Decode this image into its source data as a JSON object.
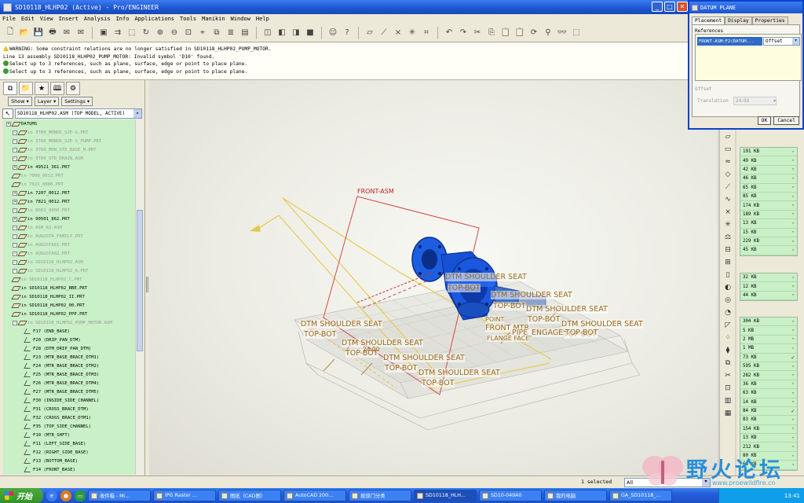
{
  "window": {
    "title": "SD10118_HLHP02 (Active) - Pro/ENGINEER",
    "controls": [
      "minimize",
      "maximize",
      "close"
    ]
  },
  "menu": [
    "File",
    "Edit",
    "View",
    "Insert",
    "Analysis",
    "Info",
    "Applications",
    "Tools",
    "Manikin",
    "Window",
    "Help"
  ],
  "messages": [
    {
      "icon": "warning-icon",
      "text": "WARNING: Some constraint relations are no longer satisfied in SD10118_HLHP02_PUMP_MOTOR."
    },
    {
      "icon": "",
      "text": " Line 13 assembly SD10118_HLHP02_PUMP_MOTOR: Invalid symbol 'D10' found."
    },
    {
      "icon": "prompt-icon",
      "text": "Select up to 3 references, such as plane, surface, edge or point to place plane."
    },
    {
      "icon": "prompt-icon",
      "text": "Select up to 3 references, such as plane, surface, edge or point to place plane."
    }
  ],
  "left_panel": {
    "buttons": {
      "show": "Show",
      "layer": "Layer",
      "settings": "Settings"
    },
    "model_selector": "SD10118_HLHP02.ASM (TOP MODEL, ACTIVE)",
    "tree": [
      {
        "text": "DATUMS",
        "type": "folder",
        "dim": false,
        "indent": 0,
        "plus": true
      },
      {
        "text": "in 3T00_MONOD_SZE-S.PRT",
        "type": "part",
        "dim": true,
        "indent": 1,
        "plus": true
      },
      {
        "text": "in 3T00_MONOD_SZE-S_PUMP.PRT",
        "type": "part",
        "dim": true,
        "indent": 1,
        "plus": true
      },
      {
        "text": "in 3T00_MON_STD_BASE_M.PRT",
        "type": "part",
        "dim": true,
        "indent": 1,
        "plus": true
      },
      {
        "text": "in 3T00_STD_DRAIN.ASM",
        "type": "part",
        "dim": true,
        "indent": 1,
        "plus": true
      },
      {
        "text": "in 49521_361.PRT",
        "type": "part",
        "dim": false,
        "indent": 1,
        "plus": true
      },
      {
        "text": "in 7000_0012.PRT",
        "type": "part",
        "dim": true,
        "indent": 1,
        "plus": false
      },
      {
        "text": "in 7021_0000.PRT",
        "type": "part",
        "dim": true,
        "indent": 1,
        "plus": false
      },
      {
        "text": "in 7207_0012.PRT",
        "type": "part",
        "dim": false,
        "indent": 1,
        "plus": true
      },
      {
        "text": "in 7821_0012.PRT",
        "type": "part",
        "dim": false,
        "indent": 1,
        "plus": true
      },
      {
        "text": "in 8001_0000.PRT",
        "type": "part",
        "dim": true,
        "indent": 1,
        "plus": true
      },
      {
        "text": "in 90501_862.PRT",
        "type": "part",
        "dim": false,
        "indent": 1,
        "plus": true
      },
      {
        "text": "in ASM_AS.ASM",
        "type": "part",
        "dim": true,
        "indent": 1,
        "plus": true
      },
      {
        "text": "in AUGUSTA_FAMILY.PRT",
        "type": "part",
        "dim": true,
        "indent": 1,
        "plus": true
      },
      {
        "text": "in AUGUSTA01.PRT",
        "type": "part",
        "dim": true,
        "indent": 1,
        "plus": true
      },
      {
        "text": "in AUGUSTA02.PRT",
        "type": "part",
        "dim": true,
        "indent": 1,
        "plus": true
      },
      {
        "text": "in SD10118_HLHP02.ASM",
        "type": "part",
        "dim": true,
        "indent": 1,
        "plus": true
      },
      {
        "text": "in SD10118_HLHP02_A.PRT",
        "type": "part",
        "dim": true,
        "indent": 1,
        "plus": true
      },
      {
        "text": "in SD10118_HLHP02_C.PRT",
        "type": "part",
        "dim": true,
        "indent": 1,
        "plus": false
      },
      {
        "text": "in SD10118_HLHP02_BBE.PRT",
        "type": "part",
        "dim": false,
        "indent": 1,
        "plus": false
      },
      {
        "text": "in SD10118_HLHP02_II.PRT",
        "type": "part",
        "dim": false,
        "indent": 1,
        "plus": false
      },
      {
        "text": "in SD10118_HLHP02_00.PRT",
        "type": "part",
        "dim": false,
        "indent": 1,
        "plus": false
      },
      {
        "text": "in SD10118_HLHP02_PPP.PRT",
        "type": "part",
        "dim": false,
        "indent": 1,
        "plus": false
      },
      {
        "text": "in SD10118_HLHP02_PUMP_MOTOR.ASM",
        "type": "part",
        "dim": true,
        "indent": 1,
        "plus": true
      },
      {
        "text": "F17 (END_BASE)",
        "type": "feature",
        "dim": false,
        "indent": 3,
        "plus": false
      },
      {
        "text": "F20 (DRIP_PAN_DTM)",
        "type": "feature",
        "dim": false,
        "indent": 3,
        "plus": false
      },
      {
        "text": "F28 (DTM_DRIP_PAN_DTM)",
        "type": "feature",
        "dim": false,
        "indent": 3,
        "plus": false
      },
      {
        "text": "F23 (MTR_BASE_BRACE_DTM1)",
        "type": "feature",
        "dim": false,
        "indent": 3,
        "plus": false
      },
      {
        "text": "F24 (MTR_BASE_BRACE_DTM2)",
        "type": "feature",
        "dim": false,
        "indent": 3,
        "plus": false
      },
      {
        "text": "F25 (MTR_BASE_BRACE_DTM3)",
        "type": "feature",
        "dim": false,
        "indent": 3,
        "plus": false
      },
      {
        "text": "F26 (MTR_BASE_BRACE_DTM4)",
        "type": "feature",
        "dim": false,
        "indent": 3,
        "plus": false
      },
      {
        "text": "F27 (MTR_BASE_BRACE_DTM5)",
        "type": "feature",
        "dim": false,
        "indent": 3,
        "plus": false
      },
      {
        "text": "F30 (INSIDE_SIDE_CHANNEL)",
        "type": "feature",
        "dim": false,
        "indent": 3,
        "plus": false
      },
      {
        "text": "F31 (CROSS_BRACE_DTM)",
        "type": "feature",
        "dim": false,
        "indent": 3,
        "plus": false
      },
      {
        "text": "F32 (CROSS_BRACE_DTM1)",
        "type": "feature",
        "dim": false,
        "indent": 3,
        "plus": false
      },
      {
        "text": "F35 (TOP_SIDE_CHANNEL)",
        "type": "feature",
        "dim": false,
        "indent": 3,
        "plus": false
      },
      {
        "text": "F10 (MTR_SHFT)",
        "type": "feature",
        "dim": false,
        "indent": 3,
        "plus": false
      },
      {
        "text": "F11 (LEFT_SIDE_BASE)",
        "type": "feature",
        "dim": false,
        "indent": 3,
        "plus": false
      },
      {
        "text": "F12 (RIGHT_SIDE_BASE)",
        "type": "feature",
        "dim": false,
        "indent": 3,
        "plus": false
      },
      {
        "text": "F13 (BOTTOM_BASE)",
        "type": "feature",
        "dim": false,
        "indent": 3,
        "plus": false
      },
      {
        "text": "F14 (FRONT_BASE)",
        "type": "feature",
        "dim": false,
        "indent": 3,
        "plus": false
      }
    ]
  },
  "viewport": {
    "labels": [
      {
        "text": "FRONT-ASM",
        "color": "red"
      },
      {
        "text": "DTM SHOULDER SEAT",
        "color": "brown"
      },
      {
        "text": "TOP-BOT",
        "color": "brown"
      },
      {
        "text": "DTM SHOULDER SEAT",
        "color": "brown"
      },
      {
        "text": "TOP-BOT",
        "color": "brown"
      },
      {
        "text": "DTM SHOULDER SEAT",
        "color": "brown"
      },
      {
        "text": "TOP-BOT",
        "color": "brown"
      },
      {
        "text": "DTM SHOULDER SEAT",
        "color": "brown"
      },
      {
        "text": "TOP-BOT",
        "color": "brown"
      },
      {
        "text": "POINT",
        "color": "brown"
      },
      {
        "text": "FRONT MTR",
        "color": "brown"
      },
      {
        "text": "PIPE_ENGAGE",
        "color": "brown"
      },
      {
        "text": "TOP-BOT",
        "color": "brown"
      },
      {
        "text": "FLANGE FACE",
        "color": "brown"
      },
      {
        "text": "DTM SHOULDER SEAT",
        "color": "brown"
      },
      {
        "text": "TOP-BOT",
        "color": "brown"
      },
      {
        "text": "DTM SHOULDER SEAT",
        "color": "brown"
      },
      {
        "text": "TOP-BOT",
        "color": "brown"
      },
      {
        "text": "24.00",
        "color": "brown"
      }
    ]
  },
  "file_list": {
    "group1": [
      {
        "size": "191 KB",
        "mark": "down"
      },
      {
        "size": "49 KB",
        "mark": "down"
      },
      {
        "size": "42 KB",
        "mark": "down"
      },
      {
        "size": "46 KB",
        "mark": "down"
      },
      {
        "size": "65 KB",
        "mark": "down"
      },
      {
        "size": "85 KB",
        "mark": "down"
      },
      {
        "size": "174 KB",
        "mark": "down"
      },
      {
        "size": "189 KB",
        "mark": "down"
      },
      {
        "size": "13 KB",
        "mark": "down"
      },
      {
        "size": "15 KB",
        "mark": "down"
      },
      {
        "size": "229 KB",
        "mark": "down"
      },
      {
        "size": "45 KB",
        "mark": "down"
      }
    ],
    "group2": [
      {
        "size": "32 KB",
        "mark": "down"
      },
      {
        "size": "12 KB",
        "mark": "down"
      },
      {
        "size": "44 KB",
        "mark": "down"
      }
    ],
    "group3": [
      {
        "size": "304 KB",
        "mark": "down"
      },
      {
        "size": "5 KB",
        "mark": "down"
      },
      {
        "size": "2 MB",
        "mark": "down"
      },
      {
        "size": "1 MB",
        "mark": "down"
      },
      {
        "size": "73 KB",
        "mark": "check"
      },
      {
        "size": "595 KB",
        "mark": "down"
      },
      {
        "size": "282 KB",
        "mark": "down"
      },
      {
        "size": "36 KB",
        "mark": "down"
      },
      {
        "size": "63 KB",
        "mark": "down"
      },
      {
        "size": "14 KB",
        "mark": "down"
      },
      {
        "size": "84 KB",
        "mark": "check"
      },
      {
        "size": "83 KB",
        "mark": "down"
      },
      {
        "size": "154 KB",
        "mark": "down"
      },
      {
        "size": "13 KB",
        "mark": "down"
      },
      {
        "size": "212 KB",
        "mark": "down"
      },
      {
        "size": "80 KB",
        "mark": "down"
      },
      {
        "size": "60 KB",
        "mark": "down"
      }
    ]
  },
  "status": {
    "selection": "1 selected",
    "filter": "All"
  },
  "watermark": {
    "text": "野火论坛",
    "url": "www.proewildfire.cn"
  },
  "taskbar": {
    "start": "开始",
    "tasks": [
      "收件箱 - Mi...",
      "IPG Raster ...",
      "图纸（CAD图）",
      "AutoCAD 200...",
      "按部门分类",
      "SD10118_HLH...",
      "SD10-049A0",
      "我的电脑",
      "GA_SD10118_..."
    ],
    "clock": "13:41"
  },
  "dialog": {
    "title": "DATUM PLANE",
    "tabs": [
      "Placement",
      "Display",
      "Properties"
    ],
    "references_label": "References",
    "reference_item": "FRONT-ASM:F2(DATUM...",
    "constraint": "Offset",
    "offset_label": "Offset",
    "translation_label": "Translation",
    "translation_value": "24.00",
    "ok": "OK",
    "cancel": "Cancel"
  }
}
